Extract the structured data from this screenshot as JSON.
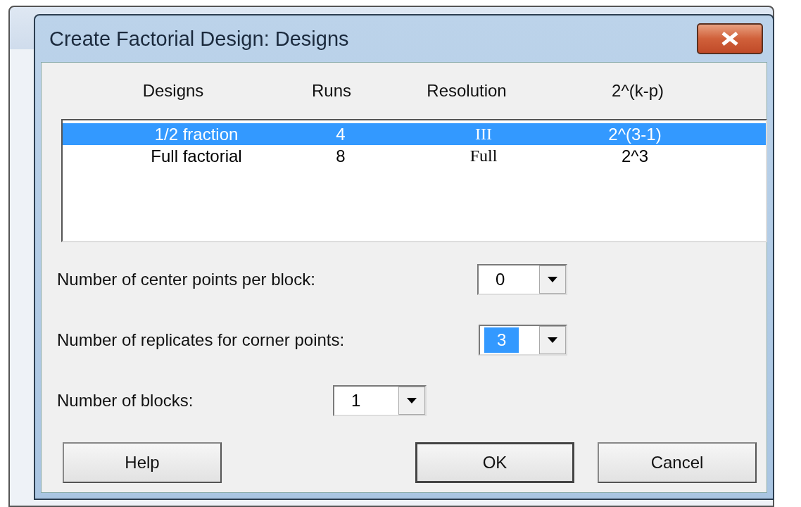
{
  "window": {
    "title": "Create Factorial Design: Designs"
  },
  "table": {
    "columns": [
      "Designs",
      "Runs",
      "Resolution",
      "2^(k-p)"
    ],
    "rows": [
      {
        "cells": [
          "1/2 fraction",
          "4",
          "III",
          "2^(3-1)"
        ],
        "selected": true
      },
      {
        "cells": [
          "Full factorial",
          "8",
          "Full",
          "2^3"
        ],
        "selected": false
      }
    ]
  },
  "fields": [
    {
      "label": "Number of center points per block:",
      "value": "0",
      "selected": false
    },
    {
      "label": "Number of replicates for corner points:",
      "value": "3",
      "selected": true
    },
    {
      "label": "Number of blocks:",
      "value": "1",
      "selected": false
    }
  ],
  "buttons": [
    {
      "label": "Help",
      "default": false
    },
    {
      "label": "OK",
      "default": true
    },
    {
      "label": "Cancel",
      "default": false
    }
  ]
}
